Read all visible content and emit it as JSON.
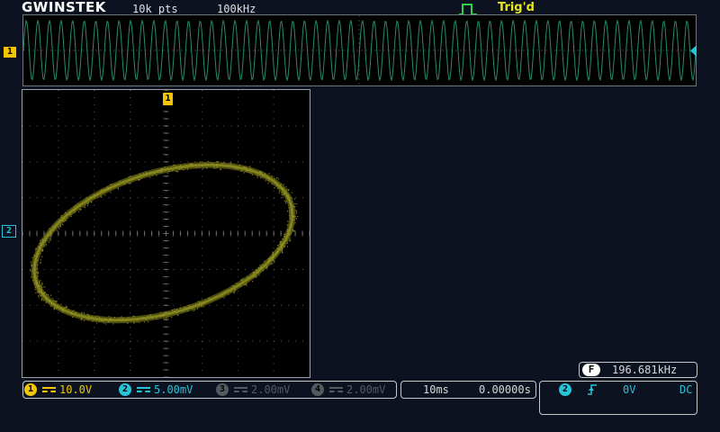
{
  "header": {
    "brand": "GWINSTEK",
    "record_length": "10k pts",
    "sample_rate": "100kHz",
    "trigger_status": "Trig'd"
  },
  "markers": {
    "ch1_side": "1",
    "ch1_top": "1",
    "ch2_side": "2"
  },
  "channels": [
    {
      "num": "1",
      "label": "10.0V",
      "color": "#f2c500",
      "active": true
    },
    {
      "num": "2",
      "label": "5.00mV",
      "color": "#27c4d8",
      "active": true
    },
    {
      "num": "3",
      "label": "2.00mV",
      "color": "#555a60",
      "active": false
    },
    {
      "num": "4",
      "label": "2.00mV",
      "color": "#555a60",
      "active": false
    }
  ],
  "timebase": {
    "scale": "10ms",
    "position": "0.00000s"
  },
  "frequency": {
    "badge": "F",
    "value": "196.681kHz"
  },
  "trigger": {
    "source": "2",
    "level": "0V",
    "coupling": "DC"
  },
  "colors": {
    "ch1": "#f2c500",
    "ch2": "#27c4d8",
    "xy_trace": "#8a8a1e",
    "overview_wave": "#2a8a6a"
  }
}
